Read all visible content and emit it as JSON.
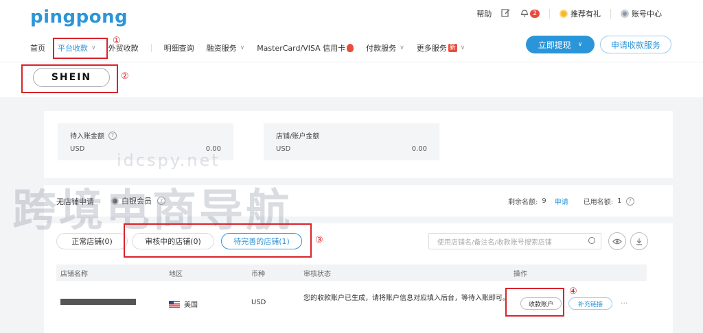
{
  "brand": {
    "logo": "pingpong"
  },
  "top_links": {
    "help": "帮助",
    "notification_count": "2",
    "referral": "推荐有礼",
    "account": "账号中心"
  },
  "nav": {
    "home": "首页",
    "platform": "平台收款",
    "foreign_trade": "外贸收款",
    "details": "明细查询",
    "finance": "融资服务",
    "card": "MasterCard/VISA 信用卡",
    "payment": "付款服务",
    "more": "更多服务",
    "new_badge": "新"
  },
  "actions": {
    "withdraw": "立即提现",
    "apply": "申请收款服务"
  },
  "platform": {
    "name": "SHEIN"
  },
  "annotations": [
    "①",
    "②",
    "③",
    "④"
  ],
  "stats": [
    {
      "label": "待入账金额",
      "currency": "USD",
      "amount": "0.00"
    },
    {
      "label": "店铺/账户金额",
      "currency": "USD",
      "amount": "0.00"
    }
  ],
  "watermark": {
    "main": "跨境电商导航",
    "url": "idcspy.net"
  },
  "store_info": {
    "no_store": "无店铺申请",
    "member": "白银会员",
    "remaining_label": "剩余名额:",
    "remaining_value": "9",
    "apply_link": "申请",
    "used_label": "已用名额:",
    "used_value": "1"
  },
  "tabs": [
    {
      "label": "正常店铺(0)"
    },
    {
      "label": "审核中的店铺(0)"
    },
    {
      "label": "待完善的店铺(1)"
    }
  ],
  "search": {
    "placeholder": "使用店铺名/备注名/收款账号搜索店铺"
  },
  "table": {
    "headers": [
      "店铺名称",
      "地区",
      "币种",
      "审核状态",
      "操作"
    ],
    "rows": [
      {
        "region": "美国",
        "currency": "USD",
        "status": "您的收款账户已生成，请将账户信息对应填入后台，等待入账即可。",
        "action_account": "收款账户",
        "action_link": "补充链接",
        "more": "···"
      }
    ]
  }
}
